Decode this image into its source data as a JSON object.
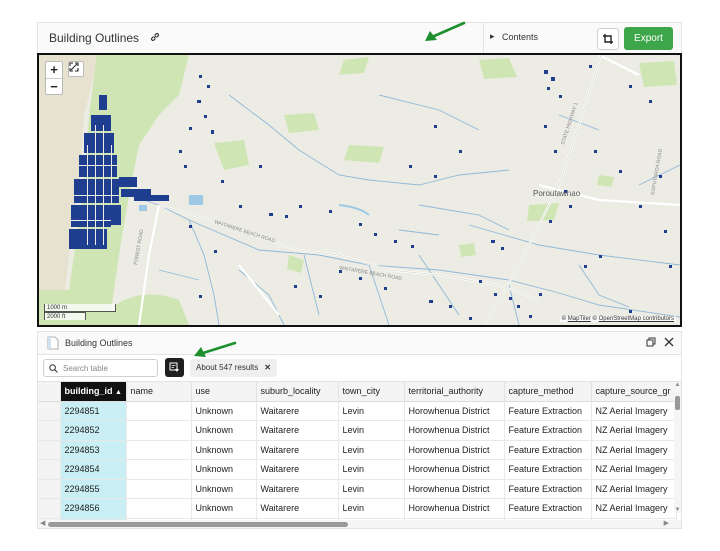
{
  "header": {
    "title": "Building Outlines",
    "contents_label": "Contents",
    "export_label": "Export"
  },
  "map": {
    "zoom_in": "+",
    "zoom_out": "−",
    "scale_metric": "1000 m",
    "scale_imperial": "2000 ft",
    "attribution_prefix": "© ",
    "attribution_maptiler": "MapTiler",
    "attribution_mid": " © ",
    "attribution_osm": "OpenStreetMap contributors",
    "place_names": [
      "Poroutawhao"
    ],
    "road_labels": [
      "WAITARERE BEACH ROAD",
      "FOREST ROAD",
      "STATE HIGHWAY 1",
      "KOPUTAROA ROAD"
    ],
    "colors": {
      "land": "#ecece4",
      "park": "#cfe6b4",
      "building": "#1f3e8f",
      "water": "#9ec9e4",
      "road": "#ffffff"
    }
  },
  "table_panel": {
    "title": "Building Outlines",
    "search_placeholder": "Search table",
    "results_label": "About 547 results",
    "columns": [
      "building_id",
      "name",
      "use",
      "suburb_locality",
      "town_city",
      "territorial_authority",
      "capture_method",
      "capture_source_gr"
    ],
    "sorted_column": "building_id",
    "sort_direction": "ascending",
    "rows": [
      [
        "2294851",
        "",
        "Unknown",
        "Waitarere",
        "Levin",
        "Horowhenua District",
        "Feature Extraction",
        "NZ Aerial Imagery"
      ],
      [
        "2294852",
        "",
        "Unknown",
        "Waitarere",
        "Levin",
        "Horowhenua District",
        "Feature Extraction",
        "NZ Aerial Imagery"
      ],
      [
        "2294853",
        "",
        "Unknown",
        "Waitarere",
        "Levin",
        "Horowhenua District",
        "Feature Extraction",
        "NZ Aerial Imagery"
      ],
      [
        "2294854",
        "",
        "Unknown",
        "Waitarere",
        "Levin",
        "Horowhenua District",
        "Feature Extraction",
        "NZ Aerial Imagery"
      ],
      [
        "2294855",
        "",
        "Unknown",
        "Waitarere",
        "Levin",
        "Horowhenua District",
        "Feature Extraction",
        "NZ Aerial Imagery"
      ],
      [
        "2294856",
        "",
        "Unknown",
        "Waitarere",
        "Levin",
        "Horowhenua District",
        "Feature Extraction",
        "NZ Aerial Imagery"
      ],
      [
        "",
        "",
        "",
        "",
        "",
        "",
        "",
        ""
      ]
    ]
  },
  "annotations": {
    "arrow_color": "#1e8f2e"
  },
  "colors": {
    "accent_green": "#3ea64a",
    "selected_header": "#111111",
    "selected_cell": "#c9eef3"
  }
}
